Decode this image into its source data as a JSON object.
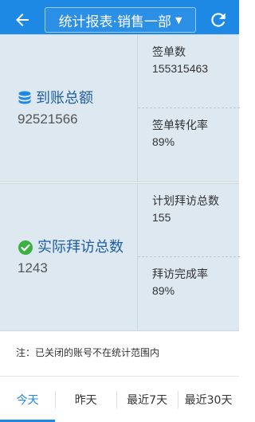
{
  "header": {
    "title": "统计报表·销售一部",
    "caret": "▼",
    "back_icon": "arrow-left-icon",
    "refresh_icon": "refresh-icon",
    "bg_color": "#1e88e5"
  },
  "card1": {
    "icon": "database-icon",
    "title": "到账总额",
    "value": "92521566",
    "stats": [
      {
        "label": "签单数",
        "value": "155315463"
      },
      {
        "label": "签单转化率",
        "value": "89%"
      }
    ]
  },
  "card2": {
    "icon": "check-circle-icon",
    "title": "实际拜访总数",
    "value": "1243",
    "stats": [
      {
        "label": "计划拜访总数",
        "value": "155"
      },
      {
        "label": "拜访完成率",
        "value": "89%"
      }
    ]
  },
  "note": "注：已关闭的账号不在统计范围内",
  "tabs": [
    {
      "label": "今天",
      "active": true
    },
    {
      "label": "昨天",
      "active": false
    },
    {
      "label": "最近7天",
      "active": false
    },
    {
      "label": "最近30天",
      "active": false
    }
  ]
}
